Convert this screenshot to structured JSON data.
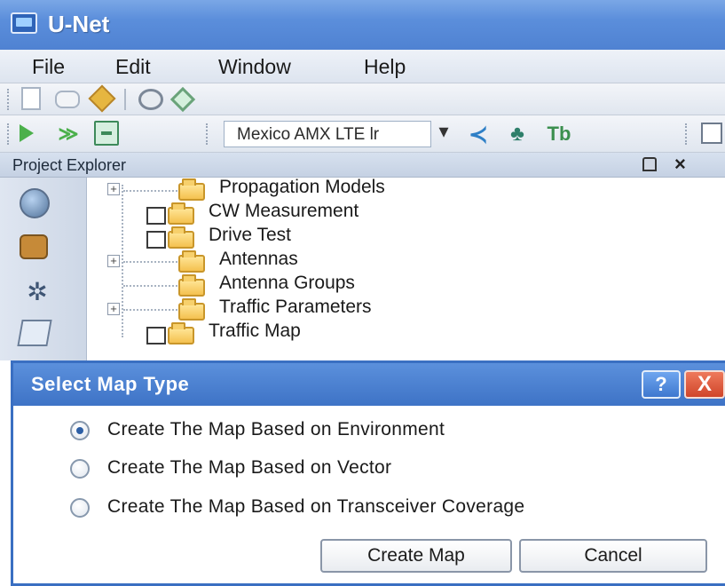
{
  "window": {
    "title": "U-Net"
  },
  "menu": [
    "File",
    "Edit",
    "Window",
    "Help"
  ],
  "toolbar": {
    "project_select": "Mexico AMX LTE lr"
  },
  "panel": {
    "title": "Project Explorer",
    "close": "×"
  },
  "tree": [
    {
      "label": "Propagation Models",
      "expander": "+"
    },
    {
      "label": "CW Measurement"
    },
    {
      "label": "Drive Test"
    },
    {
      "label": "Antennas",
      "expander": "+"
    },
    {
      "label": "Antenna Groups"
    },
    {
      "label": "Traffic Parameters",
      "expander": "+"
    },
    {
      "label": "Traffic Map"
    }
  ],
  "dialog": {
    "title": "Select Map Type",
    "help": "?",
    "close": "X",
    "options": [
      {
        "label": "Create The Map Based on Environment",
        "selected": true
      },
      {
        "label": "Create The Map Based on Vector",
        "selected": false
      },
      {
        "label": "Create The Map Based on Transceiver Coverage",
        "selected": false
      }
    ],
    "create_label": "Create Map",
    "cancel_label": "Cancel"
  },
  "colors": {
    "title_bar": "#4f82d2",
    "dialog_title": "#3e73c6",
    "close_red": "#d0452a"
  }
}
